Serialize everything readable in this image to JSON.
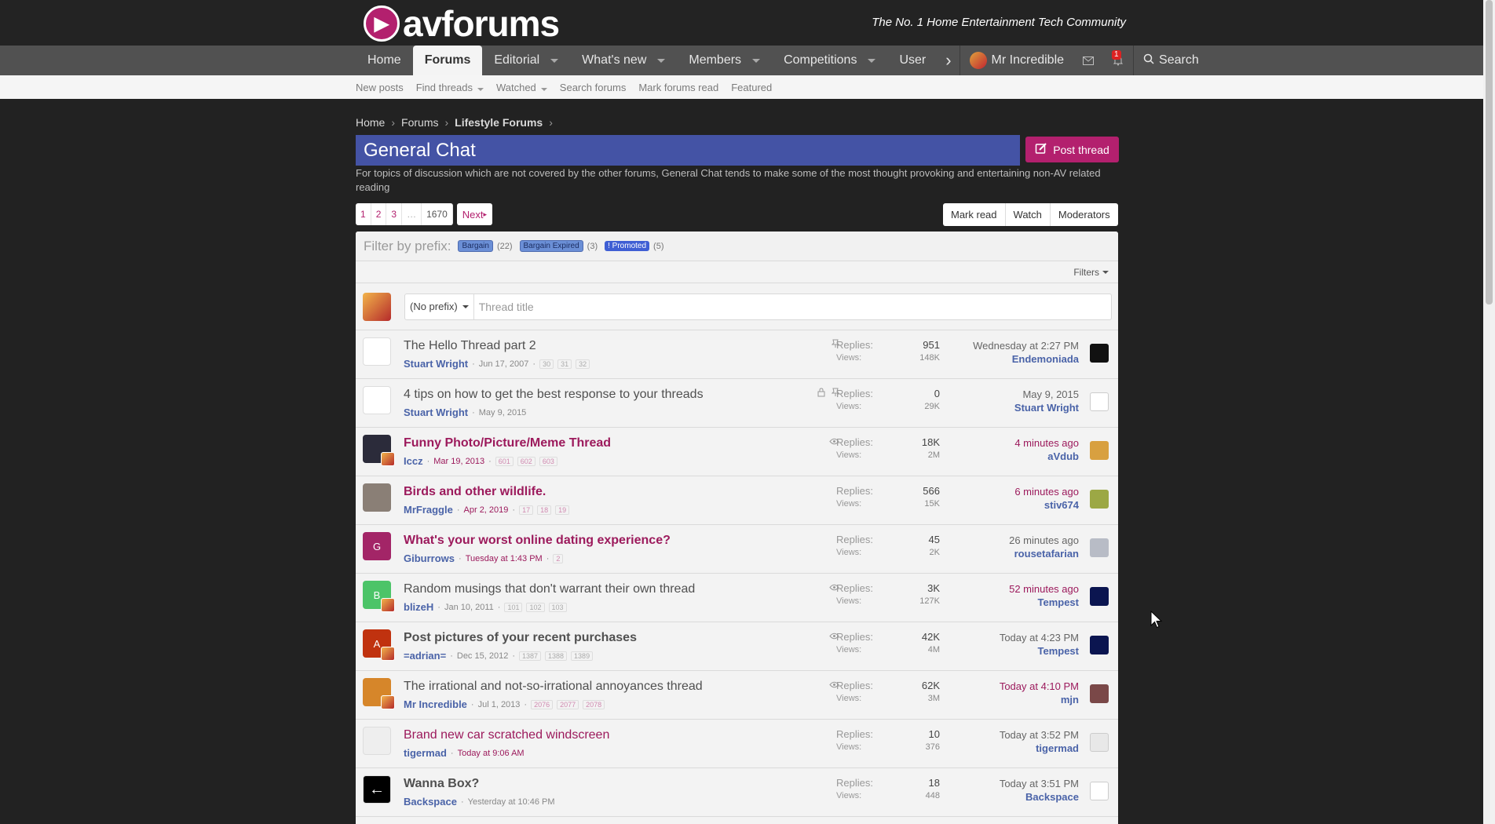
{
  "header": {
    "logo_text": "avforums",
    "tagline": "The No. 1 Home Entertainment Tech Community"
  },
  "nav": {
    "tabs": [
      {
        "label": "Home",
        "active": false,
        "caret": false
      },
      {
        "label": "Forums",
        "active": true,
        "caret": false
      },
      {
        "label": "Editorial",
        "active": false,
        "caret": true
      },
      {
        "label": "What's new",
        "active": false,
        "caret": true
      },
      {
        "label": "Members",
        "active": false,
        "caret": true
      },
      {
        "label": "Competitions",
        "active": false,
        "caret": true
      },
      {
        "label": "User",
        "active": false,
        "caret": false
      }
    ],
    "user_name": "Mr Incredible",
    "alert_count": "1",
    "search_label": "Search"
  },
  "subnav": {
    "items": [
      {
        "label": "New posts",
        "caret": false
      },
      {
        "label": "Find threads",
        "caret": true
      },
      {
        "label": "Watched",
        "caret": true
      },
      {
        "label": "Search forums",
        "caret": false
      },
      {
        "label": "Mark forums read",
        "caret": false
      },
      {
        "label": "Featured",
        "caret": false
      }
    ]
  },
  "breadcrumb": [
    "Home",
    "Forums",
    "Lifestyle Forums"
  ],
  "page": {
    "title": "General Chat",
    "post_thread_label": "Post thread",
    "description": "For topics of discussion which are not covered by the other forums, General Chat tends to make some of the most thought provoking and entertaining non-AV related reading"
  },
  "pagination": {
    "pages": [
      "1",
      "2",
      "3",
      "…",
      "1670"
    ],
    "next_label": "Next"
  },
  "actions": [
    "Mark read",
    "Watch",
    "Moderators"
  ],
  "filter": {
    "label": "Filter by prefix:",
    "prefixes": [
      {
        "name": "Bargain",
        "count": "(22)"
      },
      {
        "name": "Bargain Expired",
        "count": "(3)"
      },
      {
        "name": "! Promoted",
        "count": "(5)"
      }
    ],
    "filters_label": "Filters"
  },
  "new_thread": {
    "prefix_value": "(No prefix)",
    "title_placeholder": "Thread title"
  },
  "labels": {
    "replies": "Replies:",
    "views": "Views:"
  },
  "threads": [
    {
      "title": "The Hello Thread part 2",
      "style": "normal",
      "author": "Stuart Wright",
      "date": "Jun 17, 2007",
      "pages": [
        "30",
        "31",
        "32"
      ],
      "icons": [
        "pin"
      ],
      "replies": "951",
      "views": "148K",
      "last_when": "Wednesday at 2:27 PM",
      "last_who": "Endemoniada",
      "unread": false,
      "av_color": "#ffffff",
      "av_text": "",
      "mini": false,
      "lav_color": "#111111"
    },
    {
      "title": "4 tips on how to get the best response to your threads",
      "style": "normal",
      "author": "Stuart Wright",
      "date": "May 9, 2015",
      "pages": [],
      "icons": [
        "lock",
        "pin"
      ],
      "replies": "0",
      "views": "29K",
      "last_when": "May 9, 2015",
      "last_who": "Stuart Wright",
      "unread": false,
      "av_color": "#ffffff",
      "av_text": "",
      "mini": false,
      "lav_color": "#ffffff"
    },
    {
      "title": "Funny Photo/Picture/Meme Thread",
      "style": "unread",
      "author": "Iccz",
      "date": "Mar 19, 2013",
      "pages": [
        "601",
        "602",
        "603"
      ],
      "icons": [
        "eye"
      ],
      "replies": "18K",
      "views": "2M",
      "last_when": "4 minutes ago",
      "last_who": "aVdub",
      "unread": true,
      "av_color": "#2b2b3a",
      "av_text": "",
      "mini": true,
      "lav_color": "#d8a040"
    },
    {
      "title": "Birds and other wildlife.",
      "style": "unread",
      "author": "MrFraggle",
      "date": "Apr 2, 2019",
      "pages": [
        "17",
        "18",
        "19"
      ],
      "icons": [],
      "replies": "566",
      "views": "15K",
      "last_when": "6 minutes ago",
      "last_who": "stiv674",
      "unread": true,
      "av_color": "#8a7f76",
      "av_text": "",
      "mini": false,
      "lav_color": "#9ca845"
    },
    {
      "title": "What's your worst online dating experience?",
      "style": "unread",
      "author": "Giburrows",
      "date": "Tuesday at 1:43 PM",
      "pages": [
        "2"
      ],
      "icons": [],
      "replies": "45",
      "views": "2K",
      "last_when": "26 minutes ago",
      "last_who": "rousetafarian",
      "unread": false,
      "av_color": "#a32567",
      "av_text": "G",
      "mini": false,
      "lav_color": "#b8bcc6"
    },
    {
      "title": "Random musings that don't warrant their own thread",
      "style": "normal",
      "author": "blizeH",
      "date": "Jan 10, 2011",
      "pages": [
        "101",
        "102",
        "103"
      ],
      "icons": [
        "eye"
      ],
      "replies": "3K",
      "views": "127K",
      "last_when": "52 minutes ago",
      "last_who": "Tempest",
      "unread": true,
      "av_color": "#4cc468",
      "av_text": "B",
      "mini": true,
      "lav_color": "#0b1550"
    },
    {
      "title": "Post pictures of your recent purchases",
      "style": "bold",
      "author": "=adrian=",
      "date": "Dec 15, 2012",
      "pages": [
        "1387",
        "1388",
        "1389"
      ],
      "icons": [
        "eye"
      ],
      "replies": "42K",
      "views": "4M",
      "last_when": "Today at 4:23 PM",
      "last_who": "Tempest",
      "unread": false,
      "av_color": "#c0320f",
      "av_text": "A",
      "mini": true,
      "lav_color": "#0b1550"
    },
    {
      "title": "The irrational and not-so-irrational annoyances thread",
      "style": "normal",
      "author": "Mr Incredible",
      "date": "Jul 1, 2013",
      "pages": [
        "2076",
        "2077",
        "2078"
      ],
      "icons": [
        "eye"
      ],
      "replies": "62K",
      "views": "3M",
      "last_when": "Today at 4:10 PM",
      "last_who": "mjn",
      "unread": true,
      "av_color": "#d6862a",
      "av_text": "",
      "mini": true,
      "lav_color": "#7a4848"
    },
    {
      "title": "Brand new car scratched windscreen",
      "style": "unreadnb",
      "author": "tigermad",
      "date": "Today at 9:06 AM",
      "pages": [],
      "icons": [],
      "replies": "10",
      "views": "376",
      "last_when": "Today at 3:52 PM",
      "last_who": "tigermad",
      "unread": false,
      "av_color": "#eeeeee",
      "av_text": "",
      "mini": false,
      "lav_color": "#e8e8e8"
    },
    {
      "title": "Wanna Box?",
      "style": "bold",
      "author": "Backspace",
      "date": "Yesterday at 10:46 PM",
      "pages": [],
      "icons": [],
      "replies": "18",
      "views": "448",
      "last_when": "Today at 3:51 PM",
      "last_who": "Backspace",
      "unread": false,
      "av_color": "#ffffff",
      "av_text": "←",
      "mini": false,
      "lav_color": "#ffffff"
    }
  ]
}
